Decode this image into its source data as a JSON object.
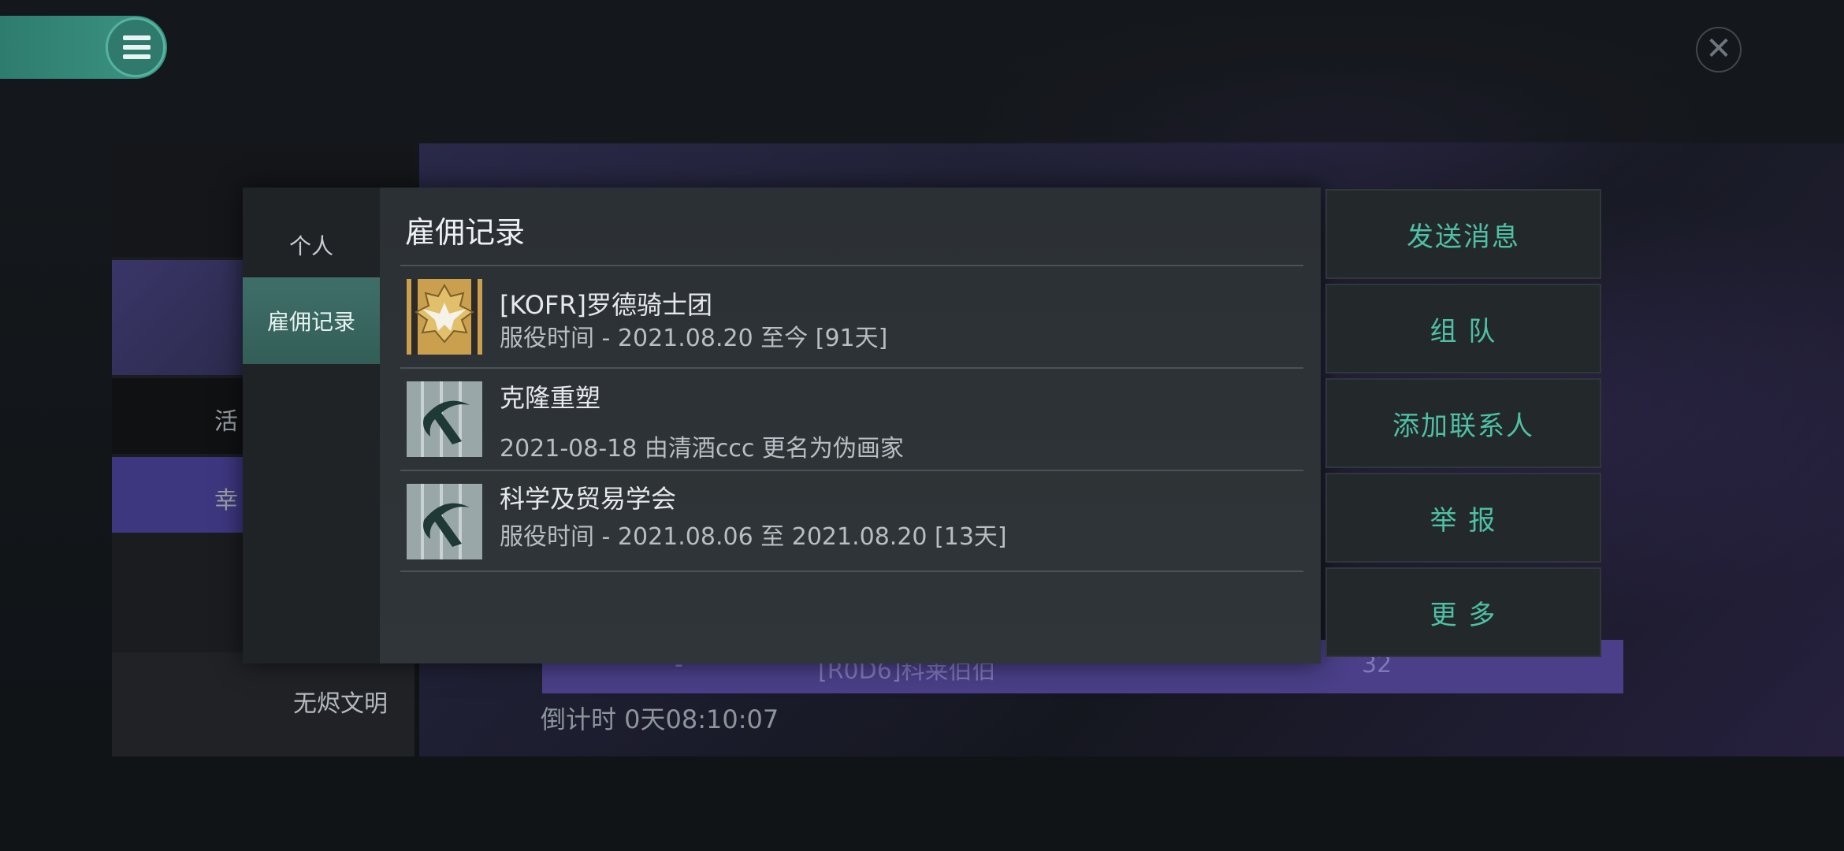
{
  "background": {
    "list_items": [
      "活",
      "幸",
      "无烬文明"
    ],
    "row_text": [
      "-",
      "[R0D6]科莱伯伯",
      "32"
    ],
    "countdown": "倒计时 0天08:10:07"
  },
  "modal": {
    "tabs": [
      {
        "label": "个人",
        "active": false
      },
      {
        "label": "雇佣记录",
        "active": true
      }
    ],
    "title": "雇佣记录",
    "records": [
      {
        "name": "[KOFR]罗德骑士团",
        "detail": "服役时间 - 2021.08.20 至今 [91天]",
        "badge": "gold-eagle-icon"
      },
      {
        "name": "克隆重塑",
        "detail": "2021-08-18 由清酒ccc 更名为伪画家",
        "badge": "corp-logo-icon"
      },
      {
        "name": "科学及贸易学会",
        "detail": "服役时间 - 2021.08.06 至 2021.08.20 [13天]",
        "badge": "corp-logo-icon"
      }
    ]
  },
  "actions": [
    "发送消息",
    "组 队",
    "添加联系人",
    "举 报",
    "更 多"
  ],
  "colors": {
    "accent": "#4fc0a6",
    "tab_active": "#3a6863",
    "menu": "#3c9583"
  }
}
